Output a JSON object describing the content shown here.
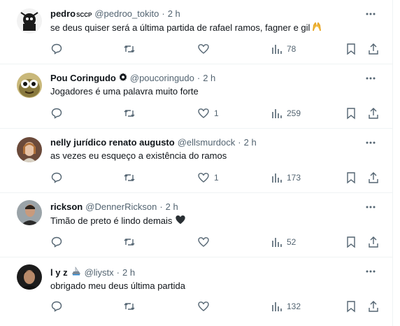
{
  "tweets": [
    {
      "name": "pedro",
      "name_tag": "SCCP",
      "handle": "@pedroo_tokito",
      "dot": "·",
      "time": "2 h",
      "text": "se deus quiser será a última partida de rafael ramos, fagner e gil",
      "text_emoji": "raised-hands",
      "reply_count": "",
      "retweet_count": "",
      "like_count": "",
      "view_count": "78"
    },
    {
      "name": "Pou Coringudo",
      "handle": "@poucoringudo",
      "dot": "·",
      "time": "2 h",
      "text": "Jogadores é uma palavra muito forte",
      "reply_count": "",
      "retweet_count": "",
      "like_count": "1",
      "view_count": "259"
    },
    {
      "name": "nelly jurídico renato augusto",
      "handle": "@ellsmurdock",
      "dot": "·",
      "time": "2 h",
      "text": "as vezes eu esqueço a existência do ramos",
      "reply_count": "",
      "retweet_count": "",
      "like_count": "1",
      "view_count": "173"
    },
    {
      "name": "rickson",
      "handle": "@DennerRickson",
      "dot": "·",
      "time": "2 h",
      "text": "Timão de preto é lindo demais",
      "text_emoji": "black-heart",
      "reply_count": "",
      "retweet_count": "",
      "like_count": "",
      "view_count": "52"
    },
    {
      "name": "l y z",
      "name_emoji": "crown-ship",
      "handle": "@liystx",
      "dot": "·",
      "time": "2 h",
      "text": "obrigado meu deus última partida",
      "reply_count": "",
      "retweet_count": "",
      "like_count": "",
      "view_count": "132"
    }
  ],
  "colors": {
    "text_primary": "#0f1419",
    "text_secondary": "#536471",
    "divider": "#eff3f4"
  }
}
